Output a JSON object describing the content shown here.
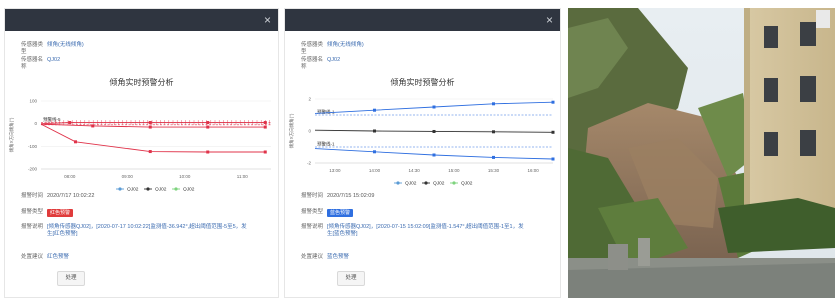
{
  "panels": [
    {
      "close_label": "×",
      "sensor_type_label": "传感器类型",
      "sensor_type_value": "倾角(无线倾角)",
      "sensor_name_label": "传感器名称",
      "sensor_name_value": "QJ02",
      "chart_title": "倾角实时预警分析",
      "alarm_time_label": "报警时间",
      "alarm_time_value": "2020/7/17 10:02:22",
      "alarm_type_label": "报警类型",
      "alarm_type_value": "红色预警",
      "alarm_desc_label": "报警说明",
      "alarm_desc_value": "[倾角传感器QJ02]，[2020-07-17 10:02:22]监测值-36.942°,超出阈值范围-5至5，发生[红色预警]",
      "suggestion_label": "处置建议",
      "suggestion_value": "红色预警",
      "button_label": "处理"
    },
    {
      "close_label": "×",
      "sensor_type_label": "传感器类型",
      "sensor_type_value": "倾角(无线倾角)",
      "sensor_name_label": "传感器名称",
      "sensor_name_value": "QJ02",
      "chart_title": "倾角实时预警分析",
      "alarm_time_label": "报警时间",
      "alarm_time_value": "2020/7/15 15:02:09",
      "alarm_type_label": "报警类型",
      "alarm_type_value": "蓝色预警",
      "alarm_desc_label": "报警说明",
      "alarm_desc_value": "[倾角传感器QJ02]，[2020-07-15 15:02:09]监测值-1.547°,超出阈值范围-1至1，发生[蓝色预警]",
      "suggestion_label": "处置建议",
      "suggestion_value": "蓝色预警",
      "button_label": "处理"
    }
  ],
  "chart_data": [
    {
      "type": "line",
      "title": "倾角实时预警分析",
      "ylabel": "倾角X方向倾角(°)",
      "ylim": [
        -200,
        100
      ],
      "yticks": [
        "100",
        "0",
        "-100",
        "-200"
      ],
      "x": [
        "08:00",
        "09:00",
        "10:00",
        "11:00"
      ],
      "threshold_label": "预警线-5",
      "series": [
        {
          "name": "QJ02",
          "color": "#e0334a",
          "points": [
            [
              7.0,
              -2
            ],
            [
              7.9,
              -10
            ],
            [
              8.9,
              -15
            ],
            [
              9.9,
              -15
            ],
            [
              10.9,
              -15
            ]
          ]
        },
        {
          "name": "QJ02",
          "color": "#e0334a",
          "points": [
            [
              7.0,
              -2
            ],
            [
              7.6,
              -80
            ],
            [
              8.9,
              -123
            ],
            [
              9.9,
              -125
            ],
            [
              10.9,
              -125
            ]
          ]
        },
        {
          "name": "QJ02",
          "color": "#e0334a",
          "points": [
            [
              7.0,
              0
            ],
            [
              7.5,
              5
            ],
            [
              8.9,
              5
            ],
            [
              9.9,
              5
            ],
            [
              10.9,
              5
            ]
          ]
        }
      ],
      "legend": [
        {
          "name": "QJ02",
          "color": "#5b9bd5"
        },
        {
          "name": "QJ02",
          "color": "#333333"
        },
        {
          "name": "QJ02",
          "color": "#7dd37d"
        }
      ]
    },
    {
      "type": "line",
      "title": "倾角实时预警分析",
      "ylabel": "倾角X方向倾角(°)",
      "ylim": [
        -2,
        2
      ],
      "yticks": [
        "2",
        "0",
        "-2"
      ],
      "x": [
        "13:00",
        "14:00",
        "14:30",
        "15:00",
        "15:30",
        "16:00"
      ],
      "threshold_upper_label": "预警线-1",
      "threshold_lower_label": "预警线-1",
      "series": [
        {
          "name": "QJ02",
          "color": "#2f6fe0",
          "points": [
            [
              0,
              1.1
            ],
            [
              2,
              1.3
            ],
            [
              4,
              1.5
            ],
            [
              6,
              1.7
            ],
            [
              8,
              1.8
            ]
          ]
        },
        {
          "name": "QJ02",
          "color": "#333333",
          "points": [
            [
              0,
              0.05
            ],
            [
              2,
              0.0
            ],
            [
              4,
              -0.03
            ],
            [
              6,
              -0.05
            ],
            [
              8,
              -0.08
            ]
          ]
        },
        {
          "name": "QJ02",
          "color": "#2f6fe0",
          "points": [
            [
              0,
              -1.1
            ],
            [
              2,
              -1.3
            ],
            [
              4,
              -1.5
            ],
            [
              6,
              -1.65
            ],
            [
              8,
              -1.75
            ]
          ]
        }
      ],
      "legend": [
        {
          "name": "QJ02",
          "color": "#5b9bd5"
        },
        {
          "name": "QJ02",
          "color": "#333333"
        },
        {
          "name": "QJ02",
          "color": "#7dd37d"
        }
      ]
    }
  ]
}
